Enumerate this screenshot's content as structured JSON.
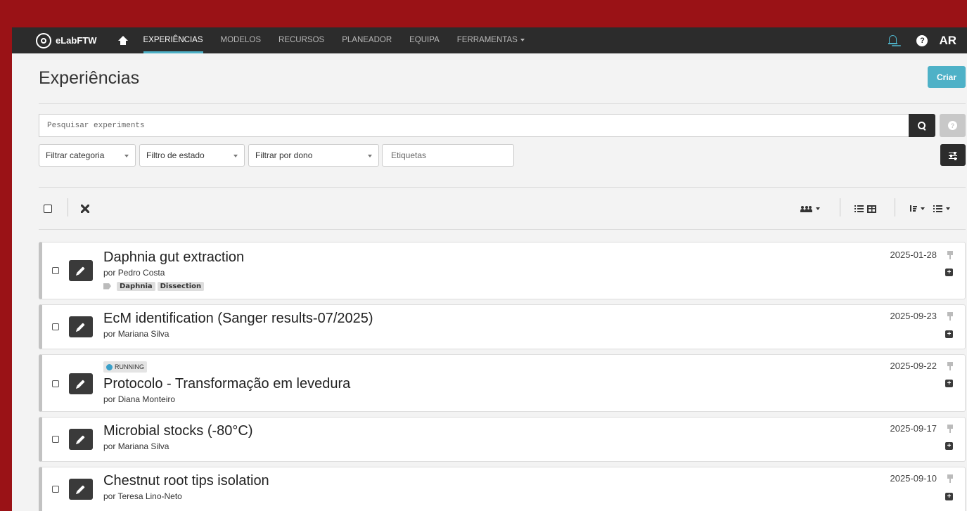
{
  "navbar": {
    "brand": "eLabFTW",
    "links": [
      {
        "label": "EXPERIÊNCIAS",
        "active": true
      },
      {
        "label": "MODELOS"
      },
      {
        "label": "RECURSOS"
      },
      {
        "label": "PLANEADOR"
      },
      {
        "label": "EQUIPA"
      },
      {
        "label": "FERRAMENTAS"
      }
    ],
    "avatar": "AR",
    "help": "?"
  },
  "header": {
    "title": "Experiências",
    "create_label": "Criar"
  },
  "search": {
    "placeholder": "Pesquisar experiments",
    "help": "?"
  },
  "filters": {
    "category": "Filtrar categoria",
    "status": "Filtro de estado",
    "owner": "Filtrar por dono",
    "tags_placeholder": "Etiquetas"
  },
  "colors": {
    "accent": "#4eb1c7",
    "navbar": "#2c2c2c",
    "outer_background": "#9a1216",
    "status_running": "#3aa0c9"
  },
  "entities": [
    {
      "title": "Daphnia gut extraction",
      "owner_prefix": "por",
      "owner": "Pedro Costa",
      "date": "2025-01-28",
      "tags": [
        "Daphnia",
        "Dissection"
      ]
    },
    {
      "title": "EcM identification (Sanger results-07/2025)",
      "owner_prefix": "por",
      "owner": "Mariana Silva",
      "date": "2025-09-23"
    },
    {
      "title": "Protocolo - Transformação em levedura",
      "owner_prefix": "por",
      "owner": "Diana Monteiro",
      "date": "2025-09-22",
      "status": "RUNNING"
    },
    {
      "title": "Microbial stocks (-80°C)",
      "owner_prefix": "por",
      "owner": "Mariana Silva",
      "date": "2025-09-17"
    },
    {
      "title": "Chestnut root tips isolation",
      "owner_prefix": "por",
      "owner": "Teresa Lino-Neto",
      "date": "2025-09-10"
    }
  ]
}
